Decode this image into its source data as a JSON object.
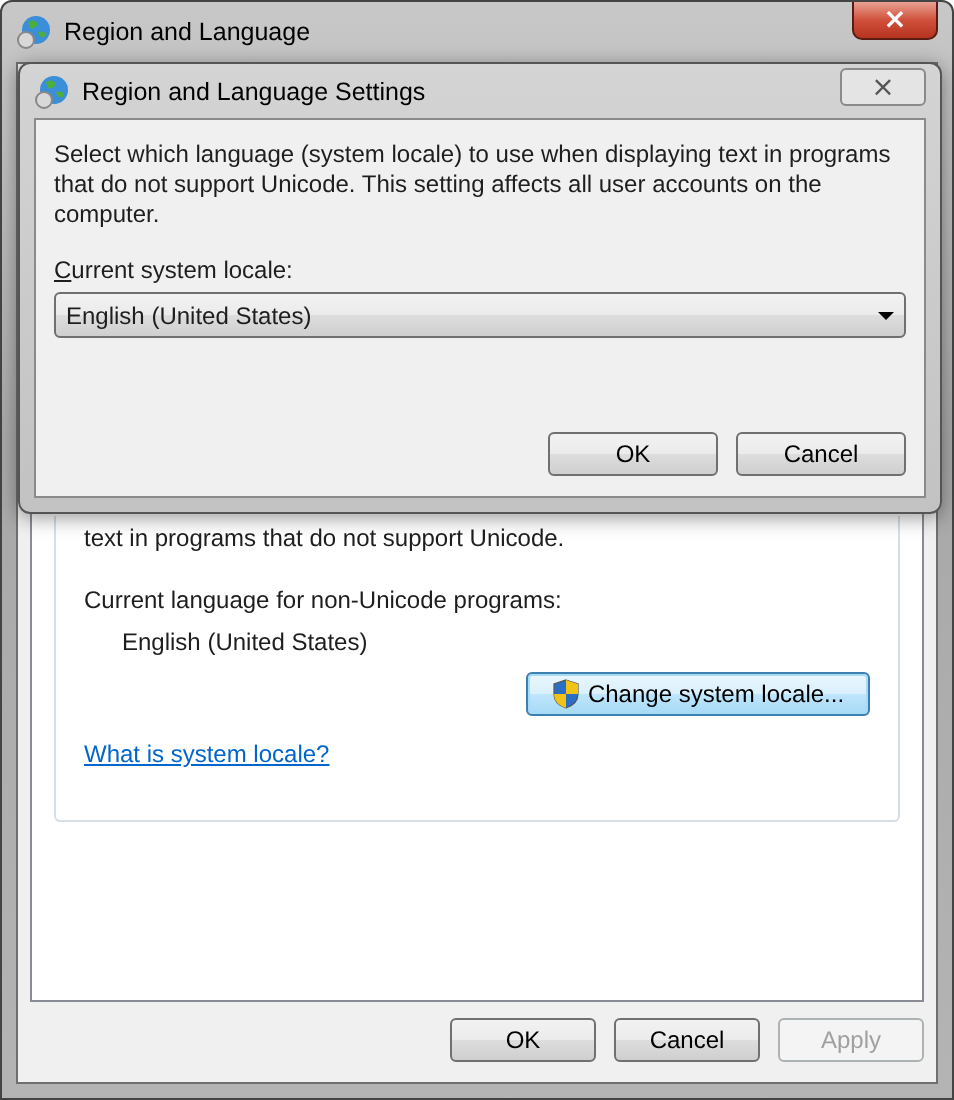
{
  "window": {
    "title": "Region and Language",
    "close": "×"
  },
  "page": {
    "text": "text in programs that do not support Unicode.",
    "current_label": "Current language for non-Unicode programs:",
    "current_value": "English (United States)",
    "change_button": "Change system locale...",
    "link": "What is system locale?"
  },
  "buttons": [
    {
      "label": "OK",
      "disabled": false
    },
    {
      "label": "Cancel",
      "disabled": false
    },
    {
      "label": "Apply",
      "disabled": true
    }
  ],
  "dialog": {
    "title": "Region and Language Settings",
    "close": "×",
    "description": "Select which language (system locale) to use when displaying text in programs that do not support Unicode. This setting affects all user accounts on the computer.",
    "locale_label": "Current system locale:",
    "locale_value": "English (United States)",
    "buttons": [
      {
        "label": "OK",
        "disabled": false
      },
      {
        "label": "Cancel",
        "disabled": false
      }
    ]
  }
}
